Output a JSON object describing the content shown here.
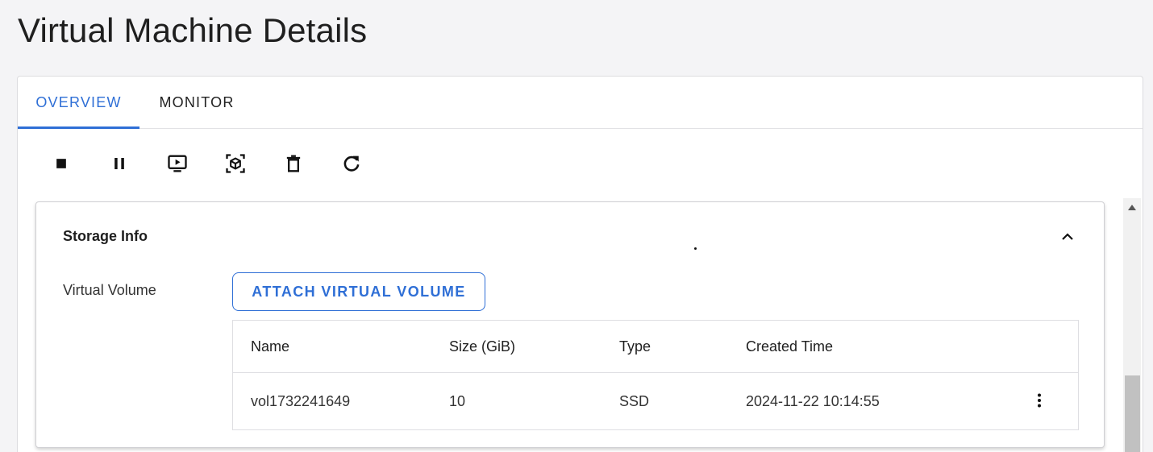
{
  "page": {
    "title": "Virtual Machine Details"
  },
  "tabs": [
    {
      "label": "OVERVIEW",
      "active": true
    },
    {
      "label": "MONITOR",
      "active": false
    }
  ],
  "toolbar": {
    "actions": [
      {
        "icon": "stop-icon"
      },
      {
        "icon": "pause-icon"
      },
      {
        "icon": "console-icon"
      },
      {
        "icon": "snapshot-icon"
      },
      {
        "icon": "delete-icon"
      },
      {
        "icon": "refresh-icon"
      }
    ]
  },
  "storage": {
    "title": "Storage Info",
    "virtual_volume_label": "Virtual Volume",
    "attach_button": "ATTACH VIRTUAL VOLUME",
    "columns": [
      "Name",
      "Size (GiB)",
      "Type",
      "Created Time"
    ],
    "rows": [
      {
        "name": "vol1732241649",
        "size": "10",
        "type": "SSD",
        "created": "2024-11-22 10:14:55"
      }
    ]
  },
  "colors": {
    "accent": "#2f6fd6",
    "background": "#f4f4f6"
  }
}
